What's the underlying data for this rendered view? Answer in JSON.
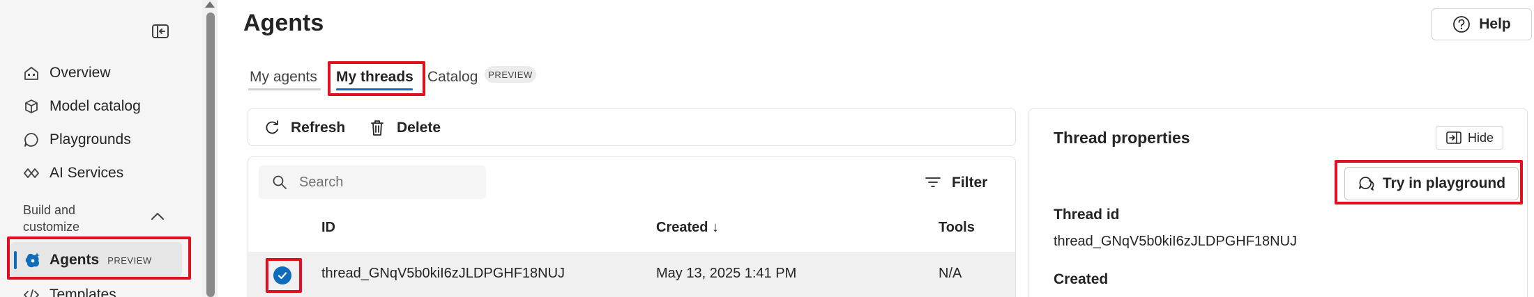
{
  "sidebar": {
    "items": [
      {
        "label": "Overview",
        "icon": "home-icon"
      },
      {
        "label": "Model catalog",
        "icon": "cube-icon"
      },
      {
        "label": "Playgrounds",
        "icon": "chat-icon"
      },
      {
        "label": "AI Services",
        "icon": "services-icon"
      }
    ],
    "section_label": "Build and customize",
    "active_item": {
      "label": "Agents",
      "badge": "PREVIEW",
      "icon": "agents-icon"
    },
    "partial_item": {
      "label": "Templates",
      "icon": "code-icon"
    }
  },
  "page": {
    "title": "Agents"
  },
  "help": {
    "label": "Help"
  },
  "tabs": {
    "items": [
      "My agents",
      "My threads",
      "Catalog"
    ],
    "active": "My threads",
    "catalog_badge": "PREVIEW"
  },
  "toolbar": {
    "refresh_label": "Refresh",
    "delete_label": "Delete"
  },
  "search": {
    "placeholder": "Search"
  },
  "filter": {
    "label": "Filter"
  },
  "table": {
    "columns": {
      "id": "ID",
      "created": "Created ↓",
      "tools": "Tools"
    },
    "rows": [
      {
        "id": "thread_GNqV5b0kiI6zJLDPGHF18NUJ",
        "created": "May 13, 2025 1:41 PM",
        "tools": "N/A",
        "selected": true
      }
    ]
  },
  "properties": {
    "title": "Thread properties",
    "hide_label": "Hide",
    "try_label": "Try in playground",
    "thread_id_label": "Thread id",
    "thread_id_value": "thread_GNqV5b0kiI6zJLDPGHF18NUJ",
    "created_label": "Created"
  },
  "colors": {
    "accent": "#0f6cbd",
    "highlight": "#e0101e"
  }
}
